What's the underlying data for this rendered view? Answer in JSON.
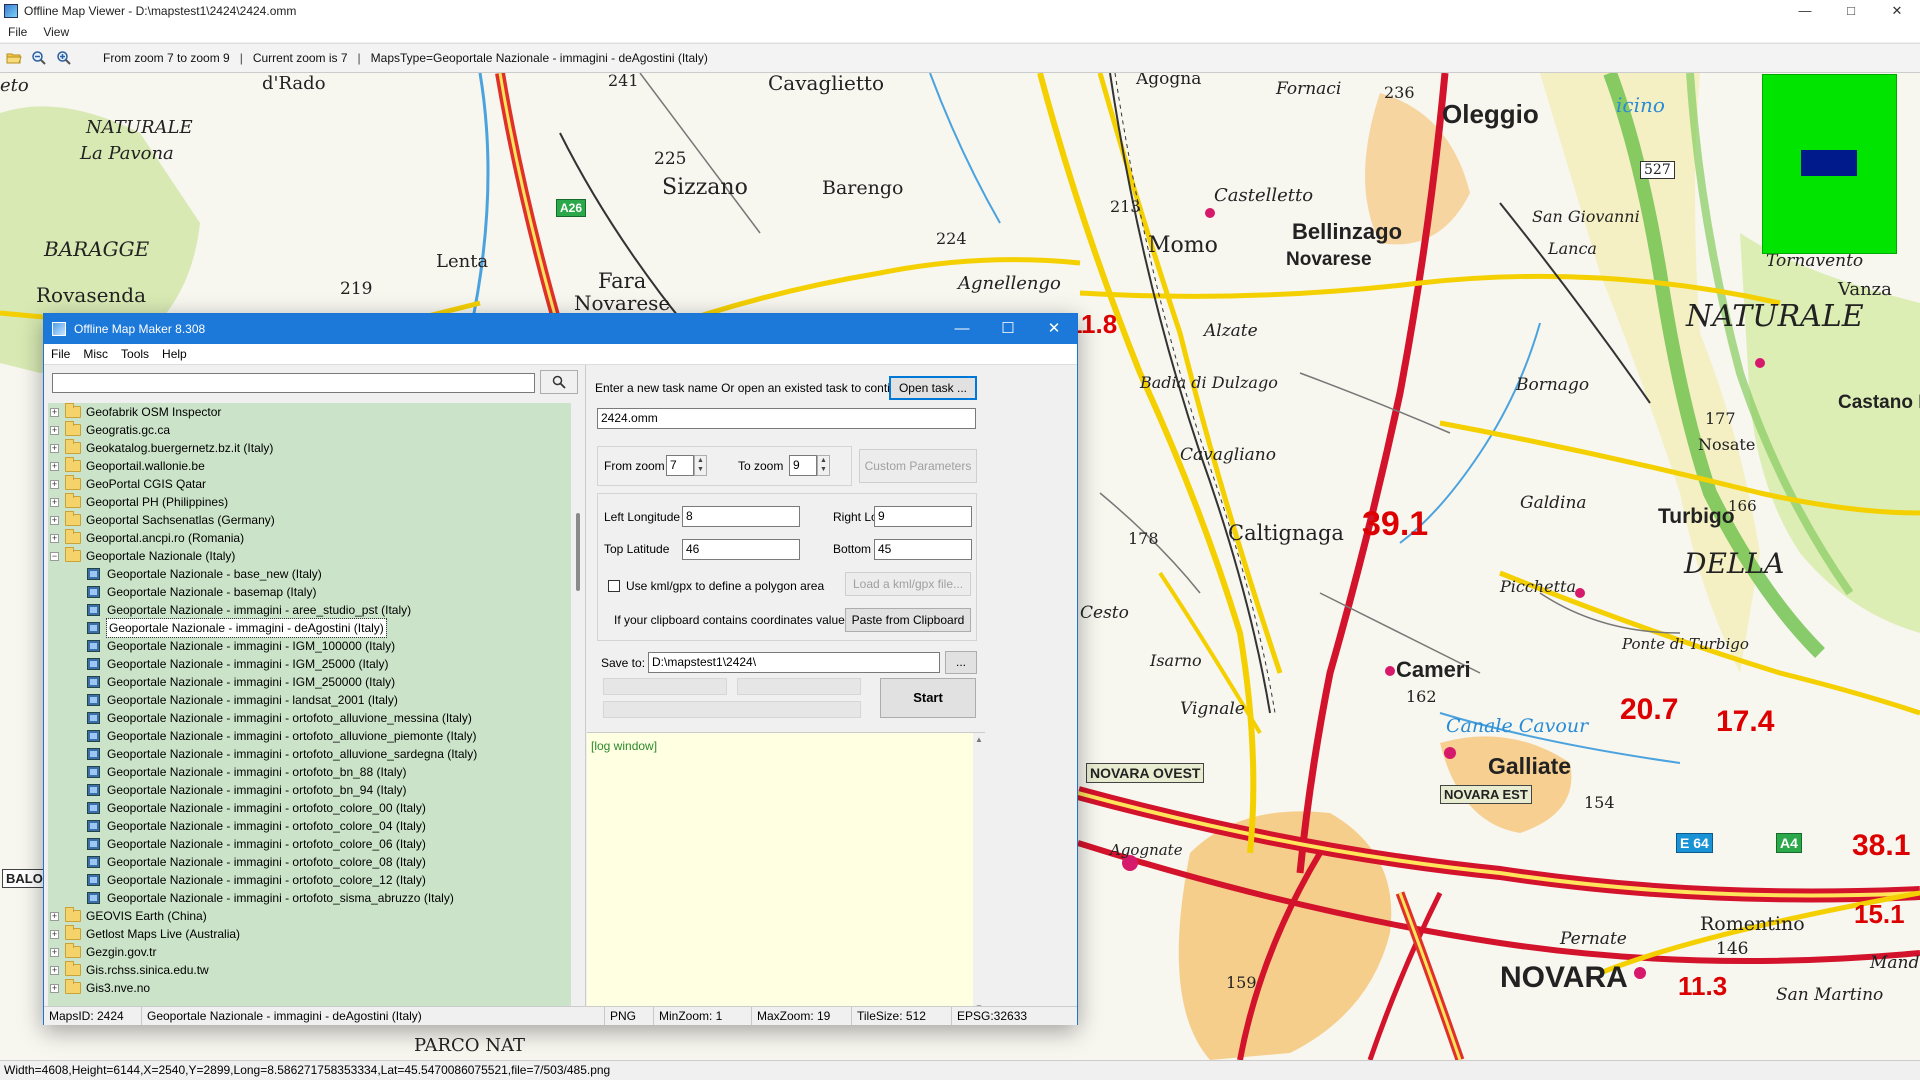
{
  "viewer": {
    "title": "Offline Map Viewer - D:\\mapstest1\\2424\\2424.omm",
    "menu": [
      "File",
      "View"
    ],
    "toolbar": {
      "zoom_range": "From zoom 7 to zoom 9",
      "current_zoom": "Current zoom is 7",
      "maps_type": "MapsType=Geoportale Nazionale - immagini - deAgostini (Italy)",
      "separator": "|"
    },
    "status": "Width=4608,Height=6144,X=2540,Y=2899,Long=8.586271758353334,Lat=45.5470086075521,file=7/503/485.png",
    "window_controls": [
      "—",
      "□",
      "✕"
    ]
  },
  "map": {
    "labels": [
      {
        "text": "eto",
        "cls": "ital",
        "size": 18
      },
      {
        "text": "d'Rado",
        "cls": "",
        "size": 18
      },
      {
        "text": "241",
        "cls": "",
        "size": 16
      },
      {
        "text": "Cavaglietto",
        "cls": "",
        "size": 20
      },
      {
        "text": "Agogna",
        "cls": "",
        "size": 17
      },
      {
        "text": "Fornaci",
        "cls": "ital",
        "size": 17
      },
      {
        "text": "236",
        "cls": "",
        "size": 16
      },
      {
        "text": "Oleggio",
        "cls": "big",
        "size": 26
      },
      {
        "text": "icino",
        "cls": "blue",
        "size": 20
      },
      {
        "text": "NATURALE",
        "cls": "ital",
        "size": 18
      },
      {
        "text": "La Pavona",
        "cls": "ital",
        "size": 18
      },
      {
        "text": "225",
        "cls": "",
        "size": 17
      },
      {
        "text": "Sizzano",
        "cls": "",
        "size": 22
      },
      {
        "text": "Barengo",
        "cls": "",
        "size": 19
      },
      {
        "text": "Castelletto",
        "cls": "ital",
        "size": 18
      },
      {
        "text": "527",
        "cls": "",
        "size": 14
      },
      {
        "text": "San Giovanni",
        "cls": "ital",
        "size": 16
      },
      {
        "text": "BARAGGE",
        "cls": "ital",
        "size": 20
      },
      {
        "text": "Lenta",
        "cls": "",
        "size": 18
      },
      {
        "text": "213",
        "cls": "",
        "size": 16
      },
      {
        "text": "Momo",
        "cls": "",
        "size": 22
      },
      {
        "text": "224",
        "cls": "",
        "size": 16
      },
      {
        "text": "Bellinzago",
        "cls": "big",
        "size": 22
      },
      {
        "text": "Novarese",
        "cls": "big",
        "size": 19
      },
      {
        "text": "Lanca",
        "cls": "ital",
        "size": 16
      },
      {
        "text": "Tornavento",
        "cls": "ital",
        "size": 17
      },
      {
        "text": "Rovasenda",
        "cls": "",
        "size": 20
      },
      {
        "text": "219",
        "cls": "",
        "size": 17
      },
      {
        "text": "Fara",
        "cls": "",
        "size": 21
      },
      {
        "text": "Novarese",
        "cls": "",
        "size": 20
      },
      {
        "text": "Agnellengo",
        "cls": "ital",
        "size": 18
      },
      {
        "text": "NATURALE",
        "cls": "ital",
        "size": 30
      },
      {
        "text": "Vanza",
        "cls": "",
        "size": 18
      },
      {
        "text": "Alzate",
        "cls": "ital",
        "size": 17
      },
      {
        "text": "Badia di Dulzago",
        "cls": "ital",
        "size": 16
      },
      {
        "text": "Bornago",
        "cls": "ital",
        "size": 17
      },
      {
        "text": "177",
        "cls": "",
        "size": 16
      },
      {
        "text": "Nosate",
        "cls": "",
        "size": 16
      },
      {
        "text": "Castano Primo",
        "cls": "big",
        "size": 19
      },
      {
        "text": "Cavagliano",
        "cls": "ital",
        "size": 17
      },
      {
        "text": "Galdina",
        "cls": "ital",
        "size": 17
      },
      {
        "text": "166",
        "cls": "",
        "size": 15
      },
      {
        "text": "Turbigo",
        "cls": "big",
        "size": 21
      },
      {
        "text": "DELLA",
        "cls": "ital",
        "size": 28
      },
      {
        "text": "178",
        "cls": "",
        "size": 16
      },
      {
        "text": "Caltignaga",
        "cls": "",
        "size": 21
      },
      {
        "text": "Cesto",
        "cls": "ital",
        "size": 17
      },
      {
        "text": "Picchetta",
        "cls": "ital",
        "size": 16
      },
      {
        "text": "Ponte di Turbigo",
        "cls": "ital",
        "size": 15
      },
      {
        "text": "Isarno",
        "cls": "ital",
        "size": 16
      },
      {
        "text": "Cameri",
        "cls": "big",
        "size": 22
      },
      {
        "text": "162",
        "cls": "",
        "size": 16
      },
      {
        "text": "Vignale",
        "cls": "ital",
        "size": 17
      },
      {
        "text": "Canale Cavour",
        "cls": "blue",
        "size": 19
      },
      {
        "text": "Galliate",
        "cls": "big",
        "size": 23
      },
      {
        "text": "154",
        "cls": "",
        "size": 16
      },
      {
        "text": "Agognate",
        "cls": "ital",
        "size": 15
      },
      {
        "text": "Romentino",
        "cls": "",
        "size": 19
      },
      {
        "text": "146",
        "cls": "",
        "size": 17
      },
      {
        "text": "Pernate",
        "cls": "ital",
        "size": 17
      },
      {
        "text": "NOVARA",
        "cls": "big",
        "size": 30
      },
      {
        "text": "159",
        "cls": "",
        "size": 16
      },
      {
        "text": "San Martino",
        "cls": "ital",
        "size": 17
      },
      {
        "text": "PARCO NAT",
        "cls": "",
        "size": 18
      },
      {
        "text": "Mande",
        "cls": "ital",
        "size": 17
      }
    ],
    "red_numbers": [
      {
        "text": "39.1",
        "size": 34
      },
      {
        "text": "20.7",
        "size": 30
      },
      {
        "text": "17.4",
        "size": 30
      },
      {
        "text": "38.1",
        "size": 30
      },
      {
        "text": "15.1",
        "size": 26
      },
      {
        "text": "11.3",
        "size": 26
      },
      {
        "text": "11.8",
        "size": 26
      }
    ],
    "signs": [
      "NOVARA OVEST",
      "NOVARA EST",
      "E 64",
      "A4",
      "A26",
      "BALO"
    ],
    "minimap": {
      "bg": "#00e400",
      "viewport": "#001a8c"
    }
  },
  "dialog": {
    "title": "Offline Map Maker 8.308",
    "menu": [
      "File",
      "Misc",
      "Tools",
      "Help"
    ],
    "search": {
      "value": "",
      "placeholder": ""
    },
    "tree": [
      {
        "label": "Geofabrik OSM Inspector",
        "type": "folder",
        "expander": "+"
      },
      {
        "label": "Geogratis.gc.ca",
        "type": "folder",
        "expander": "+"
      },
      {
        "label": "Geokatalog.buergernetz.bz.it (Italy)",
        "type": "folder",
        "expander": "+"
      },
      {
        "label": "Geoportail.wallonie.be",
        "type": "folder",
        "expander": "+"
      },
      {
        "label": "GeoPortal CGIS Qatar",
        "type": "folder",
        "expander": "+"
      },
      {
        "label": "Geoportal PH (Philippines)",
        "type": "folder",
        "expander": "+"
      },
      {
        "label": "Geoportal Sachsenatlas (Germany)",
        "type": "folder",
        "expander": "+"
      },
      {
        "label": "Geoportal.ancpi.ro (Romania)",
        "type": "folder",
        "expander": "+"
      },
      {
        "label": "Geoportale Nazionale (Italy)",
        "type": "folder",
        "expander": "−"
      },
      {
        "label": "Geoportale Nazionale - base_new (Italy)",
        "type": "map"
      },
      {
        "label": "Geoportale Nazionale - basemap (Italy)",
        "type": "map"
      },
      {
        "label": "Geoportale Nazionale - immagini - aree_studio_pst (Italy)",
        "type": "map"
      },
      {
        "label": "Geoportale Nazionale - immagini - deAgostini (Italy)",
        "type": "map",
        "selected": true
      },
      {
        "label": "Geoportale Nazionale - immagini - IGM_100000 (Italy)",
        "type": "map"
      },
      {
        "label": "Geoportale Nazionale - immagini - IGM_25000 (Italy)",
        "type": "map"
      },
      {
        "label": "Geoportale Nazionale - immagini - IGM_250000 (Italy)",
        "type": "map"
      },
      {
        "label": "Geoportale Nazionale - immagini - landsat_2001 (Italy)",
        "type": "map"
      },
      {
        "label": "Geoportale Nazionale - immagini - ortofoto_alluvione_messina (Italy)",
        "type": "map"
      },
      {
        "label": "Geoportale Nazionale - immagini - ortofoto_alluvione_piemonte (Italy)",
        "type": "map"
      },
      {
        "label": "Geoportale Nazionale - immagini - ortofoto_alluvione_sardegna (Italy)",
        "type": "map"
      },
      {
        "label": "Geoportale Nazionale - immagini - ortofoto_bn_88 (Italy)",
        "type": "map"
      },
      {
        "label": "Geoportale Nazionale - immagini - ortofoto_bn_94 (Italy)",
        "type": "map"
      },
      {
        "label": "Geoportale Nazionale - immagini - ortofoto_colore_00 (Italy)",
        "type": "map"
      },
      {
        "label": "Geoportale Nazionale - immagini - ortofoto_colore_04 (Italy)",
        "type": "map"
      },
      {
        "label": "Geoportale Nazionale - immagini - ortofoto_colore_06 (Italy)",
        "type": "map"
      },
      {
        "label": "Geoportale Nazionale - immagini - ortofoto_colore_08 (Italy)",
        "type": "map"
      },
      {
        "label": "Geoportale Nazionale - immagini - ortofoto_colore_12 (Italy)",
        "type": "map"
      },
      {
        "label": "Geoportale Nazionale - immagini - ortofoto_sisma_abruzzo (Italy)",
        "type": "map"
      },
      {
        "label": "GEOVIS Earth (China)",
        "type": "folder",
        "expander": "+"
      },
      {
        "label": "Getlost Maps Live (Australia)",
        "type": "folder",
        "expander": "+"
      },
      {
        "label": "Gezgin.gov.tr",
        "type": "folder",
        "expander": "+"
      },
      {
        "label": "Gis.rchss.sinica.edu.tw",
        "type": "folder",
        "expander": "+"
      },
      {
        "label": "Gis3.nve.no",
        "type": "folder",
        "expander": "+"
      }
    ],
    "task": {
      "prompt": "Enter a new task name Or open an existed task to continue:",
      "open_button": "Open task ...",
      "name_value": "2424.omm"
    },
    "zoom": {
      "from_label": "From zoom",
      "from_value": "7",
      "to_label": "To zoom",
      "to_value": "9",
      "custom_button": "Custom Parameters"
    },
    "bounds": {
      "left_label": "Left Longitude",
      "left_value": "8",
      "right_label": "Right Longitude",
      "right_value": "9",
      "top_label": "Top Latitude",
      "top_value": "46",
      "bottom_label": "Bottom Latitude",
      "bottom_value": "45"
    },
    "kml": {
      "checkbox_label": "Use kml/gpx to define a polygon area",
      "load_button": "Load a kml/gpx file...",
      "checked": false
    },
    "clipboard": {
      "prompt": "If your clipboard contains coordinates values:",
      "paste_button": "Paste from Clipboard"
    },
    "save": {
      "label": "Save to:",
      "path": "D:\\mapstest1\\2424\\",
      "browse_button": "..."
    },
    "start_button": "Start",
    "log_text": "[log window]",
    "status": {
      "maps_id": "MapsID: 2424",
      "maps_name": "Geoportale Nazionale - immagini - deAgostini (Italy)",
      "format": "PNG",
      "min_zoom": "MinZoom: 1",
      "max_zoom": "MaxZoom: 19",
      "tile_size": "TileSize: 512",
      "epsg": "EPSG:32633"
    },
    "window_controls": [
      "—",
      "☐",
      "✕"
    ]
  }
}
